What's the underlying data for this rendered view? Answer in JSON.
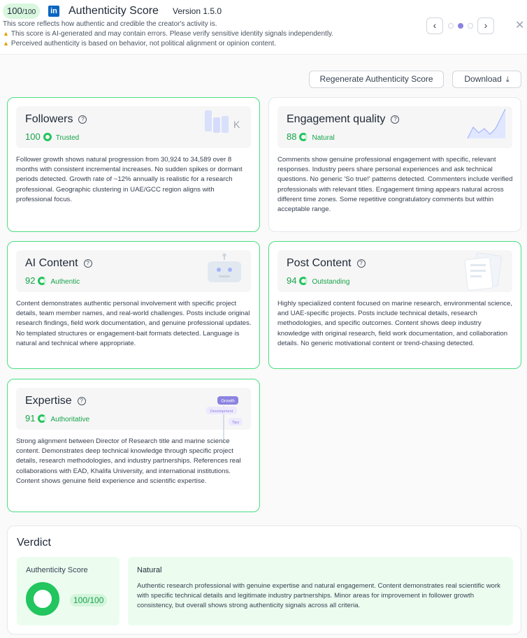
{
  "header": {
    "score_value": "100",
    "score_denominator": "/100",
    "linkedin_glyph": "in",
    "title": "Authenticity Score",
    "version": "Version 1.5.0",
    "subtitle": "This score reflects how authentic and credible the creator's activity is.",
    "warnings": [
      "This score is AI-generated and may contain errors. Please verify sensitive identity signals independently.",
      "Perceived authenticity is based on behavior, not political alignment or opinion content."
    ],
    "prev_glyph": "‹",
    "next_glyph": "›",
    "close_glyph": "✕",
    "page_dots": 3,
    "active_dot": 2,
    "warning_icon": "warning-triangle-icon"
  },
  "toolbar": {
    "regenerate_label": "Regenerate Authenticity Score",
    "download_label": "Download",
    "download_icon": "download-icon"
  },
  "cards": {
    "followers": {
      "title": "Followers",
      "score": "100",
      "score_level": 1.0,
      "label": "Trusted",
      "body": "Follower growth shows natural progression from 30,924 to 34,589 over 8 months with consistent incremental increases. No sudden spikes or dormant periods detected. Growth rate of ~12% annually is realistic for a research professional. Geographic clustering in UAE/GCC region aligns with professional focus.",
      "deco_letter": "K"
    },
    "engagement": {
      "title": "Engagement quality",
      "score": "88",
      "score_level": 0.88,
      "label": "Natural",
      "body": "Comments show genuine professional engagement with specific, relevant responses. Industry peers share personal experiences and ask technical questions. No generic 'So true!' patterns detected. Commenters include verified professionals with relevant titles. Engagement timing appears natural across different time zones. Some repetitive congratulatory comments but within acceptable range."
    },
    "ai_content": {
      "title": "AI Content",
      "score": "92",
      "score_level": 0.92,
      "label": "Authentic",
      "body": "Content demonstrates authentic personal involvement with specific project details, team member names, and real-world challenges. Posts include original research findings, field work documentation, and genuine professional updates. No templated structures or engagement-bait formats detected. Language is natural and technical where appropriate."
    },
    "post_content": {
      "title": "Post Content",
      "score": "94",
      "score_level": 0.94,
      "label": "Outstanding",
      "body": "Highly specialized content focused on marine research, environmental science, and UAE-specific projects. Posts include technical details, research methodologies, and specific outcomes. Content shows deep industry knowledge with original research, field work documentation, and collaboration details. No generic motivational content or trend-chasing detected."
    },
    "expertise": {
      "title": "Expertise",
      "score": "91",
      "score_level": 0.91,
      "label": "Authoritative",
      "body": "Strong alignment between Director of Research title and marine science content. Demonstrates deep technical knowledge through specific project details, research methodologies, and industry partnerships. References real collaborations with EAD, Khalifa University, and international institutions. Content shows genuine field experience and scientific expertise.",
      "deco_tags": [
        "Growth",
        "Development",
        "Tips"
      ]
    }
  },
  "verdict": {
    "title": "Verdict",
    "score_label": "Authenticity Score",
    "score": "100/100",
    "score_level": 1.0,
    "verdict_title": "Natural",
    "verdict_body": "Authentic research professional with genuine expertise and natural engagement. Content demonstrates real scientific work with specific technical details and legitimate industry partnerships. Minor areas for improvement in follower growth consistency, but overall shows strong authenticity signals across all criteria."
  },
  "colors": {
    "accent_green": "#22c55e",
    "text_green": "#16a34a",
    "linkedin_blue": "#0a66c2",
    "pager_active": "#8b83e0"
  }
}
